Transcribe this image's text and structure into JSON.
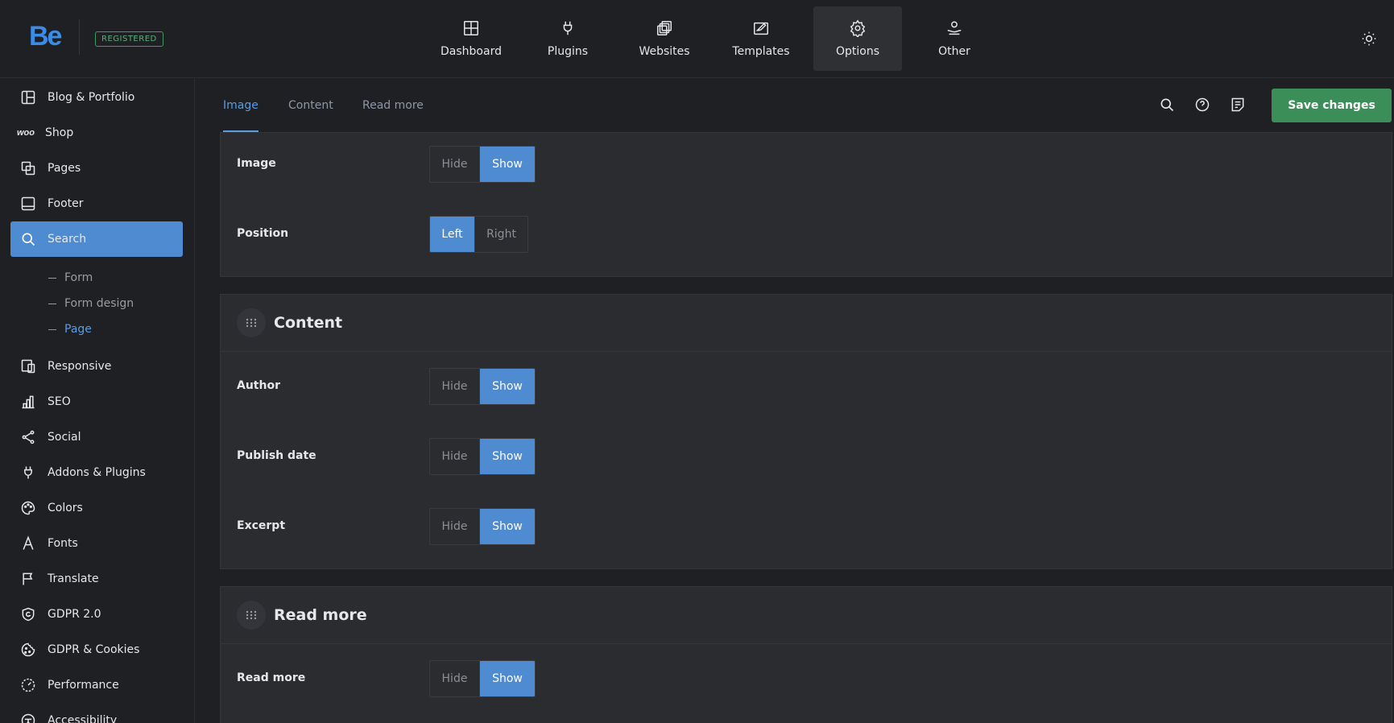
{
  "brand": {
    "logo": "Be",
    "badge": "REGISTERED"
  },
  "topnav": [
    {
      "label": "Dashboard",
      "icon": "dashboard-icon",
      "active": false
    },
    {
      "label": "Plugins",
      "icon": "plug-icon",
      "active": false
    },
    {
      "label": "Websites",
      "icon": "websites-icon",
      "active": false
    },
    {
      "label": "Templates",
      "icon": "templates-icon",
      "active": false
    },
    {
      "label": "Options",
      "icon": "gear-icon",
      "active": true
    },
    {
      "label": "Other",
      "icon": "other-icon",
      "active": false
    }
  ],
  "sidebar": {
    "items": [
      {
        "label": "Blog & Portfolio",
        "icon": "layout-icon"
      },
      {
        "label": "Shop",
        "icon": "woo-icon",
        "woo": "woo"
      },
      {
        "label": "Pages",
        "icon": "pages-icon"
      },
      {
        "label": "Footer",
        "icon": "footer-icon"
      },
      {
        "label": "Search",
        "icon": "search-icon",
        "active": true
      },
      {
        "label": "Responsive",
        "icon": "responsive-icon"
      },
      {
        "label": "SEO",
        "icon": "chart-bars-icon"
      },
      {
        "label": "Social",
        "icon": "share-icon"
      },
      {
        "label": "Addons & Plugins",
        "icon": "plug-icon"
      },
      {
        "label": "Colors",
        "icon": "palette-icon"
      },
      {
        "label": "Fonts",
        "icon": "font-icon"
      },
      {
        "label": "Translate",
        "icon": "flag-icon"
      },
      {
        "label": "GDPR 2.0",
        "icon": "shield-icon"
      },
      {
        "label": "GDPR & Cookies",
        "icon": "cookie-icon"
      },
      {
        "label": "Performance",
        "icon": "gauge-icon"
      },
      {
        "label": "Accessibility",
        "icon": "accessibility-icon"
      }
    ],
    "subitems": [
      {
        "label": "Form",
        "active": false
      },
      {
        "label": "Form design",
        "active": false
      },
      {
        "label": "Page",
        "active": true
      }
    ]
  },
  "tabs": [
    {
      "label": "Image",
      "active": true
    },
    {
      "label": "Content",
      "active": false
    },
    {
      "label": "Read more",
      "active": false
    }
  ],
  "header_actions": {
    "save_label": "Save changes"
  },
  "sections": {
    "image": {
      "rows": [
        {
          "label": "Image",
          "options": [
            "Hide",
            "Show"
          ],
          "selected": "Show"
        },
        {
          "label": "Position",
          "options": [
            "Left",
            "Right"
          ],
          "selected": "Left"
        }
      ]
    },
    "content": {
      "title": "Content",
      "rows": [
        {
          "label": "Author",
          "options": [
            "Hide",
            "Show"
          ],
          "selected": "Show"
        },
        {
          "label": "Publish date",
          "options": [
            "Hide",
            "Show"
          ],
          "selected": "Show"
        },
        {
          "label": "Excerpt",
          "options": [
            "Hide",
            "Show"
          ],
          "selected": "Show"
        }
      ]
    },
    "readmore": {
      "title": "Read more",
      "rows": [
        {
          "label": "Read more",
          "options": [
            "Hide",
            "Show"
          ],
          "selected": "Show"
        }
      ]
    }
  },
  "colors": {
    "accent": "#4f8bd0",
    "save": "#3b8e57",
    "badge": "#58b17a"
  }
}
